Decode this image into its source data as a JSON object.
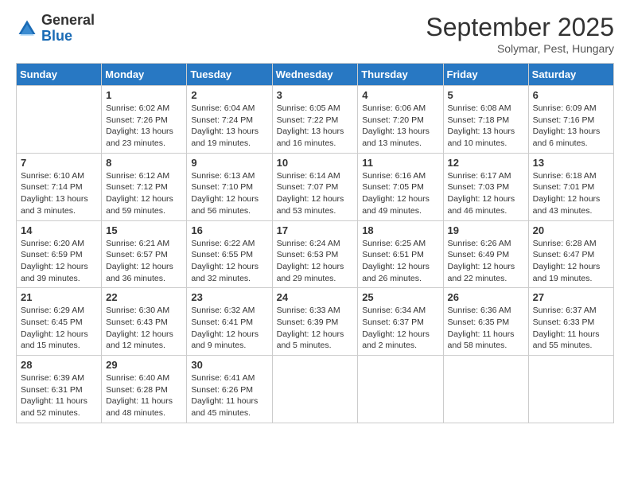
{
  "header": {
    "logo": {
      "general": "General",
      "blue": "Blue"
    },
    "title": "September 2025",
    "location": "Solymar, Pest, Hungary"
  },
  "weekdays": [
    "Sunday",
    "Monday",
    "Tuesday",
    "Wednesday",
    "Thursday",
    "Friday",
    "Saturday"
  ],
  "weeks": [
    [
      {
        "day": "",
        "sunrise": "",
        "sunset": "",
        "daylight": ""
      },
      {
        "day": "1",
        "sunrise": "Sunrise: 6:02 AM",
        "sunset": "Sunset: 7:26 PM",
        "daylight": "Daylight: 13 hours and 23 minutes."
      },
      {
        "day": "2",
        "sunrise": "Sunrise: 6:04 AM",
        "sunset": "Sunset: 7:24 PM",
        "daylight": "Daylight: 13 hours and 19 minutes."
      },
      {
        "day": "3",
        "sunrise": "Sunrise: 6:05 AM",
        "sunset": "Sunset: 7:22 PM",
        "daylight": "Daylight: 13 hours and 16 minutes."
      },
      {
        "day": "4",
        "sunrise": "Sunrise: 6:06 AM",
        "sunset": "Sunset: 7:20 PM",
        "daylight": "Daylight: 13 hours and 13 minutes."
      },
      {
        "day": "5",
        "sunrise": "Sunrise: 6:08 AM",
        "sunset": "Sunset: 7:18 PM",
        "daylight": "Daylight: 13 hours and 10 minutes."
      },
      {
        "day": "6",
        "sunrise": "Sunrise: 6:09 AM",
        "sunset": "Sunset: 7:16 PM",
        "daylight": "Daylight: 13 hours and 6 minutes."
      }
    ],
    [
      {
        "day": "7",
        "sunrise": "Sunrise: 6:10 AM",
        "sunset": "Sunset: 7:14 PM",
        "daylight": "Daylight: 13 hours and 3 minutes."
      },
      {
        "day": "8",
        "sunrise": "Sunrise: 6:12 AM",
        "sunset": "Sunset: 7:12 PM",
        "daylight": "Daylight: 12 hours and 59 minutes."
      },
      {
        "day": "9",
        "sunrise": "Sunrise: 6:13 AM",
        "sunset": "Sunset: 7:10 PM",
        "daylight": "Daylight: 12 hours and 56 minutes."
      },
      {
        "day": "10",
        "sunrise": "Sunrise: 6:14 AM",
        "sunset": "Sunset: 7:07 PM",
        "daylight": "Daylight: 12 hours and 53 minutes."
      },
      {
        "day": "11",
        "sunrise": "Sunrise: 6:16 AM",
        "sunset": "Sunset: 7:05 PM",
        "daylight": "Daylight: 12 hours and 49 minutes."
      },
      {
        "day": "12",
        "sunrise": "Sunrise: 6:17 AM",
        "sunset": "Sunset: 7:03 PM",
        "daylight": "Daylight: 12 hours and 46 minutes."
      },
      {
        "day": "13",
        "sunrise": "Sunrise: 6:18 AM",
        "sunset": "Sunset: 7:01 PM",
        "daylight": "Daylight: 12 hours and 43 minutes."
      }
    ],
    [
      {
        "day": "14",
        "sunrise": "Sunrise: 6:20 AM",
        "sunset": "Sunset: 6:59 PM",
        "daylight": "Daylight: 12 hours and 39 minutes."
      },
      {
        "day": "15",
        "sunrise": "Sunrise: 6:21 AM",
        "sunset": "Sunset: 6:57 PM",
        "daylight": "Daylight: 12 hours and 36 minutes."
      },
      {
        "day": "16",
        "sunrise": "Sunrise: 6:22 AM",
        "sunset": "Sunset: 6:55 PM",
        "daylight": "Daylight: 12 hours and 32 minutes."
      },
      {
        "day": "17",
        "sunrise": "Sunrise: 6:24 AM",
        "sunset": "Sunset: 6:53 PM",
        "daylight": "Daylight: 12 hours and 29 minutes."
      },
      {
        "day": "18",
        "sunrise": "Sunrise: 6:25 AM",
        "sunset": "Sunset: 6:51 PM",
        "daylight": "Daylight: 12 hours and 26 minutes."
      },
      {
        "day": "19",
        "sunrise": "Sunrise: 6:26 AM",
        "sunset": "Sunset: 6:49 PM",
        "daylight": "Daylight: 12 hours and 22 minutes."
      },
      {
        "day": "20",
        "sunrise": "Sunrise: 6:28 AM",
        "sunset": "Sunset: 6:47 PM",
        "daylight": "Daylight: 12 hours and 19 minutes."
      }
    ],
    [
      {
        "day": "21",
        "sunrise": "Sunrise: 6:29 AM",
        "sunset": "Sunset: 6:45 PM",
        "daylight": "Daylight: 12 hours and 15 minutes."
      },
      {
        "day": "22",
        "sunrise": "Sunrise: 6:30 AM",
        "sunset": "Sunset: 6:43 PM",
        "daylight": "Daylight: 12 hours and 12 minutes."
      },
      {
        "day": "23",
        "sunrise": "Sunrise: 6:32 AM",
        "sunset": "Sunset: 6:41 PM",
        "daylight": "Daylight: 12 hours and 9 minutes."
      },
      {
        "day": "24",
        "sunrise": "Sunrise: 6:33 AM",
        "sunset": "Sunset: 6:39 PM",
        "daylight": "Daylight: 12 hours and 5 minutes."
      },
      {
        "day": "25",
        "sunrise": "Sunrise: 6:34 AM",
        "sunset": "Sunset: 6:37 PM",
        "daylight": "Daylight: 12 hours and 2 minutes."
      },
      {
        "day": "26",
        "sunrise": "Sunrise: 6:36 AM",
        "sunset": "Sunset: 6:35 PM",
        "daylight": "Daylight: 11 hours and 58 minutes."
      },
      {
        "day": "27",
        "sunrise": "Sunrise: 6:37 AM",
        "sunset": "Sunset: 6:33 PM",
        "daylight": "Daylight: 11 hours and 55 minutes."
      }
    ],
    [
      {
        "day": "28",
        "sunrise": "Sunrise: 6:39 AM",
        "sunset": "Sunset: 6:31 PM",
        "daylight": "Daylight: 11 hours and 52 minutes."
      },
      {
        "day": "29",
        "sunrise": "Sunrise: 6:40 AM",
        "sunset": "Sunset: 6:28 PM",
        "daylight": "Daylight: 11 hours and 48 minutes."
      },
      {
        "day": "30",
        "sunrise": "Sunrise: 6:41 AM",
        "sunset": "Sunset: 6:26 PM",
        "daylight": "Daylight: 11 hours and 45 minutes."
      },
      {
        "day": "",
        "sunrise": "",
        "sunset": "",
        "daylight": ""
      },
      {
        "day": "",
        "sunrise": "",
        "sunset": "",
        "daylight": ""
      },
      {
        "day": "",
        "sunrise": "",
        "sunset": "",
        "daylight": ""
      },
      {
        "day": "",
        "sunrise": "",
        "sunset": "",
        "daylight": ""
      }
    ]
  ]
}
